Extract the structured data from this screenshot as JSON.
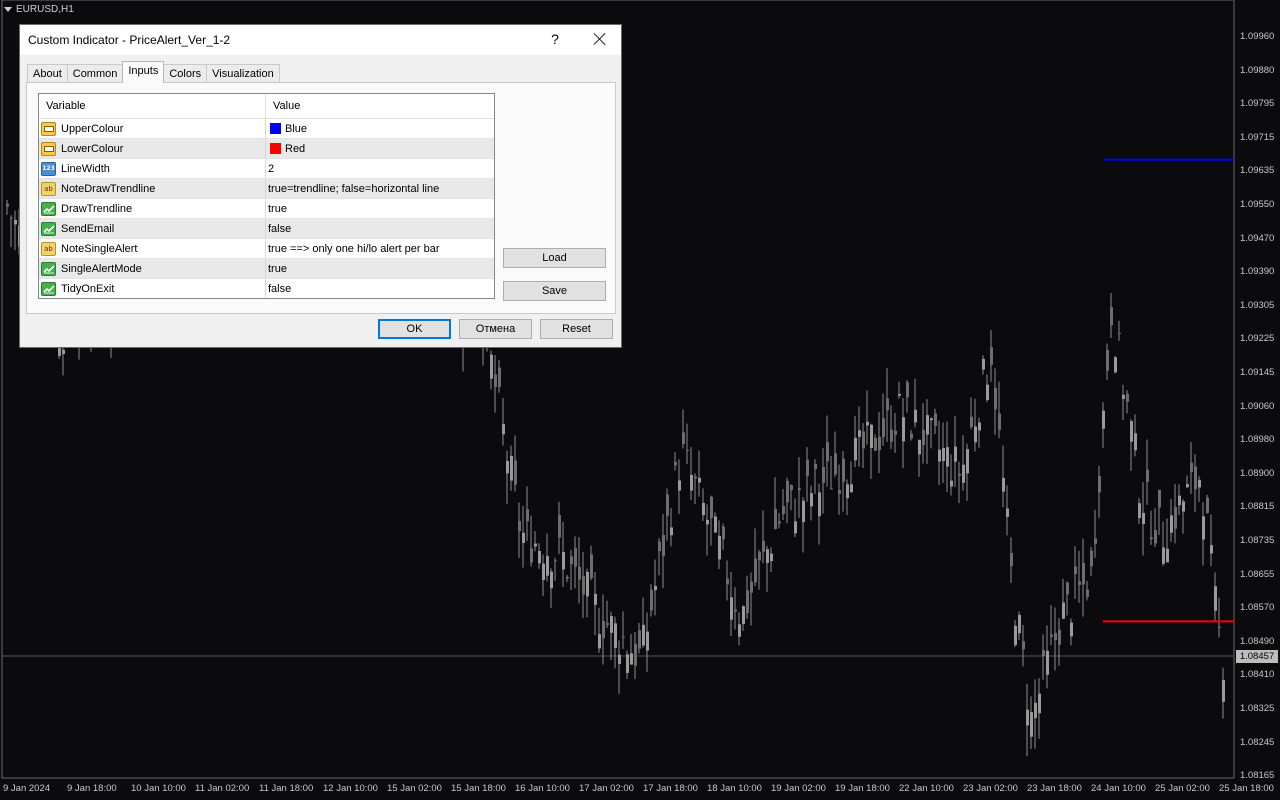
{
  "symbol": "EURUSD,H1",
  "chart": {
    "price_labels": [
      "1.09960",
      "1.09880",
      "1.09795",
      "1.09715",
      "1.09635",
      "1.09550",
      "1.09470",
      "1.09390",
      "1.09305",
      "1.09225",
      "1.09145",
      "1.09060",
      "1.08980",
      "1.08900",
      "1.08815",
      "1.08735",
      "1.08655",
      "1.08570",
      "1.08490",
      "1.08410",
      "1.08325",
      "1.08245",
      "1.08165"
    ],
    "current_price": "1.08457",
    "time_labels": [
      "9 Jan 2024",
      "9 Jan 18:00",
      "10 Jan 10:00",
      "11 Jan 02:00",
      "11 Jan 18:00",
      "12 Jan 10:00",
      "15 Jan 02:00",
      "15 Jan 18:00",
      "16 Jan 10:00",
      "17 Jan 02:00",
      "17 Jan 18:00",
      "18 Jan 10:00",
      "19 Jan 02:00",
      "19 Jan 18:00",
      "22 Jan 10:00",
      "23 Jan 02:00",
      "23 Jan 18:00",
      "24 Jan 10:00",
      "25 Jan 02:00",
      "25 Jan 18:00"
    ],
    "upper_line_color": "#0000ff",
    "lower_line_color": "#ff0000",
    "upper_line_price": 1.0966,
    "lower_line_price": 1.0854
  },
  "dialog": {
    "title": "Custom Indicator - PriceAlert_Ver_1-2",
    "help": "?",
    "tabs": [
      "About",
      "Common",
      "Inputs",
      "Colors",
      "Visualization"
    ],
    "active_tab": "Inputs",
    "columns": {
      "variable": "Variable",
      "value": "Value"
    },
    "rows": [
      {
        "name": "UpperColour",
        "value": "Blue",
        "type": "color",
        "swatch": "#0000ff"
      },
      {
        "name": "LowerColour",
        "value": "Red",
        "type": "color",
        "swatch": "#ff0000"
      },
      {
        "name": "LineWidth",
        "value": "2",
        "type": "int",
        "icon_text": "123"
      },
      {
        "name": "NoteDrawTrendline",
        "value": "true=trendline; false=horizontal line",
        "type": "string",
        "icon_text": "ab"
      },
      {
        "name": "DrawTrendline",
        "value": "true",
        "type": "bool"
      },
      {
        "name": "SendEmail",
        "value": "false",
        "type": "bool"
      },
      {
        "name": "NoteSingleAlert",
        "value": "true ==> only one hi/lo alert per bar",
        "type": "string",
        "icon_text": "ab"
      },
      {
        "name": "SingleAlertMode",
        "value": "true",
        "type": "bool"
      },
      {
        "name": "TidyOnExit",
        "value": "false",
        "type": "bool"
      }
    ],
    "buttons": {
      "load": "Load",
      "save": "Save",
      "ok": "OK",
      "cancel": "Отмена",
      "reset": "Reset"
    }
  }
}
